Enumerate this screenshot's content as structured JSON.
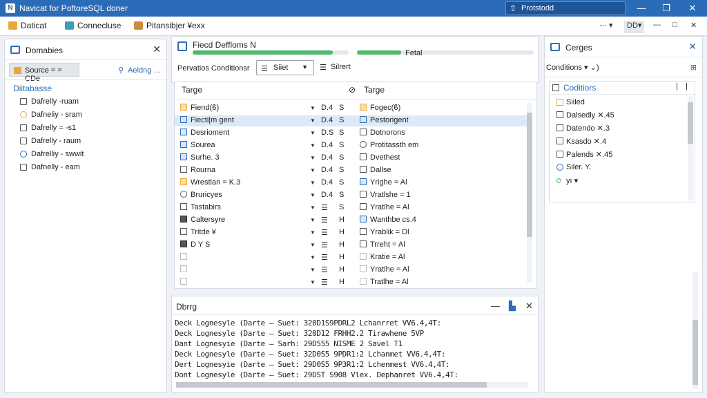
{
  "window": {
    "title": "Navicat for PoftoreSQL doner",
    "search_placeholder": "Protstodd"
  },
  "menubar": {
    "items": [
      "Daticat",
      "Connecluse",
      "Pitansibjer ¥exx"
    ],
    "view_btn": "DD▾"
  },
  "left_panel": {
    "title": "Domabies",
    "sub_label": "Source = = CDe",
    "search_link": "Aeldng …",
    "database_header": "Diitabasse",
    "items": [
      "Dafrelly ‑ruam",
      "Dafneliy ‑ sram",
      "Dafrelly = ‑s1",
      "Dafrelly ‑ raum",
      "Dafrelliy ‑ swwit",
      "Dafnelly ‑ eam"
    ]
  },
  "center_top": {
    "title": "Fiecd Deffloms N",
    "progress_label": "Fetal",
    "progress1": 0.9,
    "progress2": 0.25,
    "conditions_label": "Pervatios Conditionsr",
    "select_value": "Siiet",
    "select2_value": "Silrert"
  },
  "grid": {
    "header_left": "Targe",
    "header_mid": "⊘",
    "header_right": "Targe",
    "rows": [
      {
        "name": "Fiend(ϐ)",
        "type": "D.4",
        "s": "S",
        "target": "Fogec(ϐ)",
        "icon": "orange",
        "ticon": "orange"
      },
      {
        "name": "Fiecti|m gent",
        "type": "D.4",
        "s": "S",
        "target": "Pestorigent",
        "icon": "blue",
        "ticon": "blue",
        "selected": true
      },
      {
        "name": "Desrioment",
        "type": "D.S",
        "s": "S",
        "target": "Dotnorons",
        "icon": "blue",
        "ticon": ""
      },
      {
        "name": "Sourea",
        "type": "D.4",
        "s": "S",
        "target": "Protitassth em",
        "icon": "blue",
        "ticon": "circle"
      },
      {
        "name": "Surhe. 3",
        "type": "D.4",
        "s": "S",
        "target": "Dvethest",
        "icon": "blue",
        "ticon": ""
      },
      {
        "name": "Rourna",
        "type": "D.4",
        "s": "S",
        "target": "Dallse",
        "icon": "",
        "ticon": ""
      },
      {
        "name": "Wrestlan = K.3",
        "type": "D.4",
        "s": "S",
        "target": "Yrighe = Al",
        "icon": "orange",
        "ticon": "blue"
      },
      {
        "name": "Bruricyes",
        "type": "D.4",
        "s": "S",
        "target": "Vratlshe = 1",
        "icon": "circle",
        "ticon": ""
      },
      {
        "name": "Tastabirs",
        "type": "☰",
        "s": "S",
        "target": "Yratlhe = Al",
        "icon": "",
        "ticon": ""
      },
      {
        "name": "Caltersyre",
        "type": "☰",
        "s": "H",
        "target": "Wanthbe cs.4",
        "icon": "dark",
        "ticon": "blue"
      },
      {
        "name": "Tritde ¥",
        "type": "☰",
        "s": "H",
        "target": "Yrablik = Dl",
        "icon": "",
        "ticon": ""
      },
      {
        "name": "D Y S",
        "type": "☰",
        "s": "H",
        "target": "Trreht = Al",
        "icon": "dark",
        "ticon": ""
      },
      {
        "name": "",
        "type": "☰",
        "s": "H",
        "target": "Kratie = Al",
        "icon": "faint",
        "ticon": "faint"
      },
      {
        "name": "",
        "type": "☰",
        "s": "H",
        "target": "Yratlhe = Al",
        "icon": "faint",
        "ticon": "faint"
      },
      {
        "name": "",
        "type": "☰",
        "s": "H",
        "target": "Tratlhe = Al",
        "icon": "faint",
        "ticon": "faint"
      }
    ]
  },
  "log": {
    "title": "Dbrrg",
    "lines": [
      "Deck Lognesyle (Darte – Suet: 320D1S9PDRL2 Lchanrret VV6.4,4T:",
      "Deck Lognesyle (Darte – Suet: 320D12 FRHH2.2 Tirawhene 5VP",
      "Dant Lognesyie (Darte – Sarh: 29D555 NISME 2 Savel T1",
      "Deck Lognesyle (Darte – Suet: 32D0S5 9PDR1:2 Lchanmet VV6.4,4T:",
      "Dert Lognesyie (Darte – Suet: 29D0S5 9P3R1:2 Lchenmest VV6.4,4T:",
      "Dont Lognesyle (Darte – Suet: 29DST S908 Vlex. Dephanret VV6.4,4T:"
    ]
  },
  "right_panel": {
    "title": "Cerges",
    "conditions_label": "Conditions ▾ ⌄)",
    "link": "⊞",
    "sub_header": "Coditiors",
    "items": [
      "Siiled",
      "Dalsedly ✕.45",
      "Datendo ✕.3",
      "Ksasdo ✕.4",
      "Palends ✕.45",
      "Siler. Y.",
      "yı ▾"
    ]
  }
}
